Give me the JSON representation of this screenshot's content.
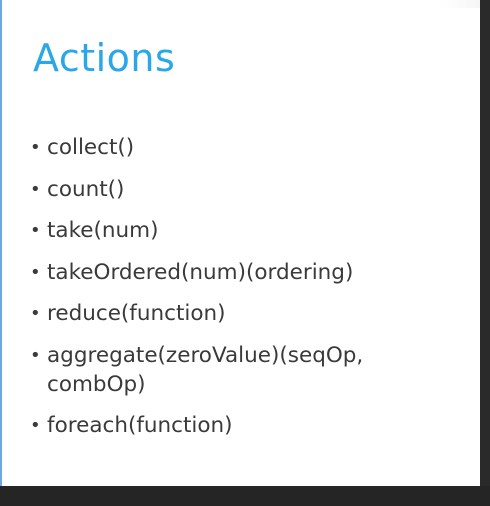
{
  "slide": {
    "title": "Actions",
    "bullet_glyph": "•",
    "items": [
      {
        "text": "collect()"
      },
      {
        "text": "count()"
      },
      {
        "text": "take(num)"
      },
      {
        "text": "takeOrdered(num)(ordering)"
      },
      {
        "text": "reduce(function)"
      },
      {
        "text": "aggregate(zeroValue)(seqOp,\ncombOp)"
      },
      {
        "text": "foreach(function)"
      }
    ]
  },
  "colors": {
    "title": "#2aa7e8",
    "body_text": "#3a3a3a",
    "slide_background": "#ffffff",
    "frame": "#1e1e1e"
  }
}
